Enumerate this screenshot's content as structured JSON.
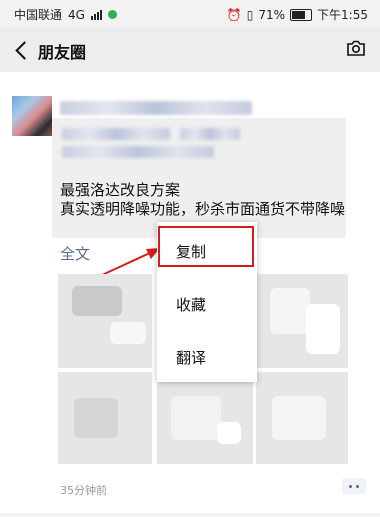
{
  "status_bar": {
    "carrier": "中国联通",
    "network": "4G",
    "network_small": "4G",
    "battery": "71%",
    "time": "下午1:55",
    "icons": [
      "wechat-dot-icon",
      "alarm-icon",
      "vibrate-icon",
      "battery-icon"
    ]
  },
  "nav": {
    "title": "朋友圈",
    "back_icon": "back-chevron-icon",
    "camera_icon": "camera-icon"
  },
  "post": {
    "text_line1": "最强洛达改良方案",
    "text_line2": "真实透明降噪功能，秒杀市面通货不带降噪",
    "full_text_link": "全文",
    "time": "35分钟前",
    "more_icon": "more-dots-icon"
  },
  "context_menu": {
    "items": [
      {
        "label": "复制"
      },
      {
        "label": "收藏"
      },
      {
        "label": "翻译"
      }
    ]
  },
  "colors": {
    "link": "#576b95",
    "highlight": "#d81b1b"
  }
}
